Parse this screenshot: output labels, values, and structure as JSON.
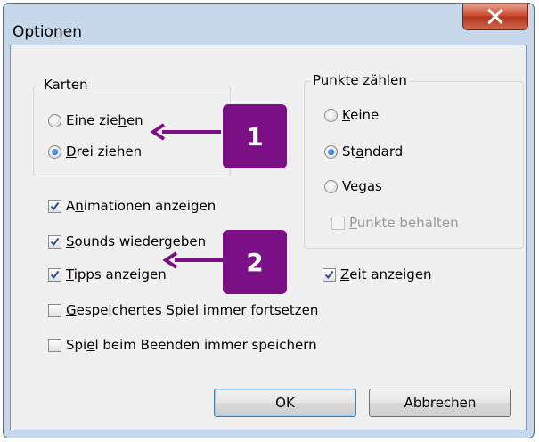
{
  "window": {
    "title": "Optionen"
  },
  "cards_group": {
    "label": "Karten",
    "options": [
      {
        "pre": "Eine zie",
        "mn": "h",
        "post": "en",
        "selected": false
      },
      {
        "pre": "",
        "mn": "D",
        "post": "rei ziehen",
        "selected": true
      }
    ]
  },
  "score_group": {
    "label": "Punkte zählen",
    "options": [
      {
        "pre": "",
        "mn": "K",
        "post": "eine",
        "selected": false
      },
      {
        "pre": "St",
        "mn": "a",
        "post": "ndard",
        "selected": true
      },
      {
        "pre": "",
        "mn": "V",
        "post": "egas",
        "selected": false
      }
    ],
    "keep_points": {
      "pre": "",
      "mn": "P",
      "post": "unkte behalten",
      "checked": false,
      "disabled": true
    }
  },
  "checkboxes": [
    {
      "pre": "A",
      "mn": "n",
      "post": "imationen anzeigen",
      "checked": true
    },
    {
      "pre": "",
      "mn": "S",
      "post": "ounds wiedergeben",
      "checked": true
    },
    {
      "pre": "",
      "mn": "T",
      "post": "ipps anzeigen",
      "checked": true
    },
    {
      "pre": "",
      "mn": "G",
      "post": "espeichertes Spiel immer fortsetzen",
      "checked": false
    },
    {
      "pre": "Spi",
      "mn": "e",
      "post": "l beim Beenden immer speichern",
      "checked": false
    }
  ],
  "time_checkbox": {
    "pre": "",
    "mn": "Z",
    "post": "eit anzeigen",
    "checked": true
  },
  "buttons": {
    "ok": "OK",
    "cancel": "Abbrechen"
  },
  "callouts": [
    {
      "number": "1"
    },
    {
      "number": "2"
    }
  ],
  "colors": {
    "callout": "#7a0f86",
    "window_frame": "#c7d8ea",
    "dialog_bg": "#f0f0f0"
  }
}
